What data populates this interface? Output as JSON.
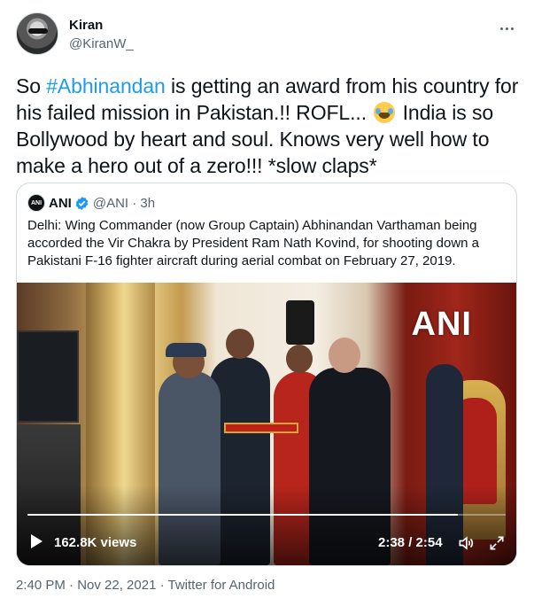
{
  "author": {
    "name": "Kiran",
    "handle": "@KiranW_"
  },
  "tweet": {
    "text_before": "So ",
    "hashtag": "#Abhinandan",
    "text_middle": " is getting an award from his country for his failed mission in Pakistan.!! ROFL... ",
    "emoji": "rolling-on-floor-laughing-emoji",
    "text_after": " India is so Bollywood by heart and soul. Knows very well how to make a hero out of a zero!!! *slow claps*"
  },
  "quoted": {
    "avatar_text": "ANI",
    "name": "ANI",
    "handle_time": "@ANI · 3h",
    "text": "Delhi: Wing Commander (now Group Captain) Abhinandan Varthaman being accorded the Vir Chakra by President Ram Nath Kovind, for shooting down a Pakistani F-16 fighter aircraft during aerial combat on February 27, 2019.",
    "video": {
      "watermark": "ANI",
      "views": "162.8K views",
      "time": "2:38 / 2:54",
      "progress": 0.9
    }
  },
  "meta": "2:40 PM · Nov 22, 2021 · Twitter for Android",
  "colors": {
    "link": "#1d9bf0",
    "secondary": "#536471",
    "verified": "#1d9bf0"
  }
}
